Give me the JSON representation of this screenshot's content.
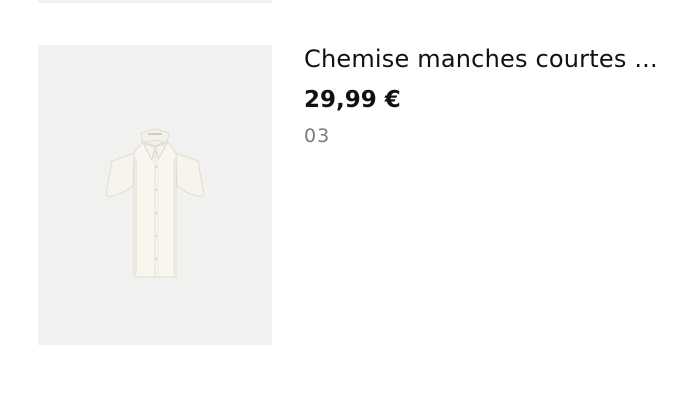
{
  "product": {
    "title": "Chemise manches courtes ...",
    "price": "29,99 €",
    "variant": "03",
    "image_subject": "white short-sleeve shirt",
    "image_background": "#f1f1ef"
  }
}
